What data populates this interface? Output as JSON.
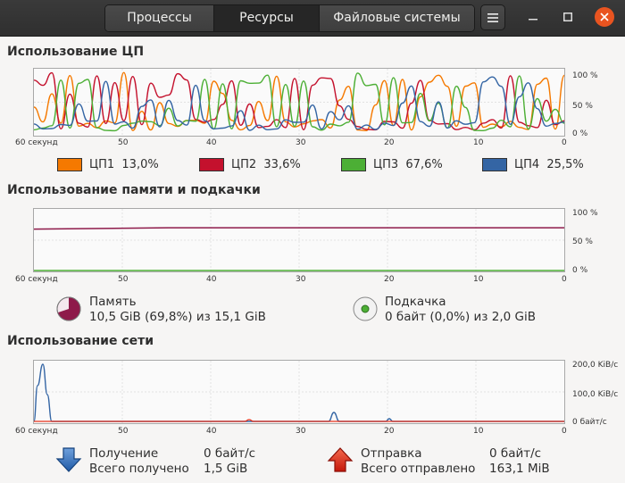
{
  "header": {
    "tabs": [
      {
        "label": "Процессы",
        "active": false
      },
      {
        "label": "Ресурсы",
        "active": true
      },
      {
        "label": "Файловые системы",
        "active": false
      }
    ],
    "menu_icon": "hamburger-menu-icon",
    "window_controls": [
      "minimize-icon",
      "maximize-icon",
      "close-icon"
    ]
  },
  "cpu": {
    "title": "Использование ЦП",
    "y_ticks": [
      "100 %",
      "50 %",
      "0 %"
    ],
    "x_ticks": [
      "60 секунд",
      "50",
      "40",
      "30",
      "20",
      "10",
      "0"
    ],
    "legend": [
      {
        "name": "ЦП1",
        "value": "13,0%",
        "color": "#f57900"
      },
      {
        "name": "ЦП2",
        "value": "33,6%",
        "color": "#c4112d"
      },
      {
        "name": "ЦП3",
        "value": "67,6%",
        "color": "#4caf35"
      },
      {
        "name": "ЦП4",
        "value": "25,5%",
        "color": "#3465a4"
      }
    ]
  },
  "memory": {
    "title": "Использование памяти и подкачки",
    "y_ticks": [
      "100 %",
      "50 %",
      "0 %"
    ],
    "x_ticks": [
      "60 секунд",
      "50",
      "40",
      "30",
      "20",
      "10",
      "0"
    ],
    "memory_label": "Память",
    "memory_value": "10,5 GiB (69,8%) из 15,1 GiB",
    "memory_color": "#8e1a4a",
    "memory_fraction": 0.698,
    "swap_label": "Подкачка",
    "swap_value": "0 байт (0,0%) из 2,0 GiB",
    "swap_color": "#4caf35",
    "swap_fraction": 0.0
  },
  "network": {
    "title": "Использование сети",
    "y_ticks": [
      "200,0 KiB/с",
      "100,0 KiB/с",
      "0 байт/с"
    ],
    "x_ticks": [
      "60 секунд",
      "50",
      "40",
      "30",
      "20",
      "10",
      "0"
    ],
    "receive_label": "Получение",
    "receive_rate": "0 байт/с",
    "receive_total_label": "Всего получено",
    "receive_total": "1,5 GiB",
    "receive_color": "#3465a4",
    "send_label": "Отправка",
    "send_rate": "0 байт/с",
    "send_total_label": "Всего отправлено",
    "send_total": "163,1 MiB",
    "send_color": "#e8311a"
  }
}
